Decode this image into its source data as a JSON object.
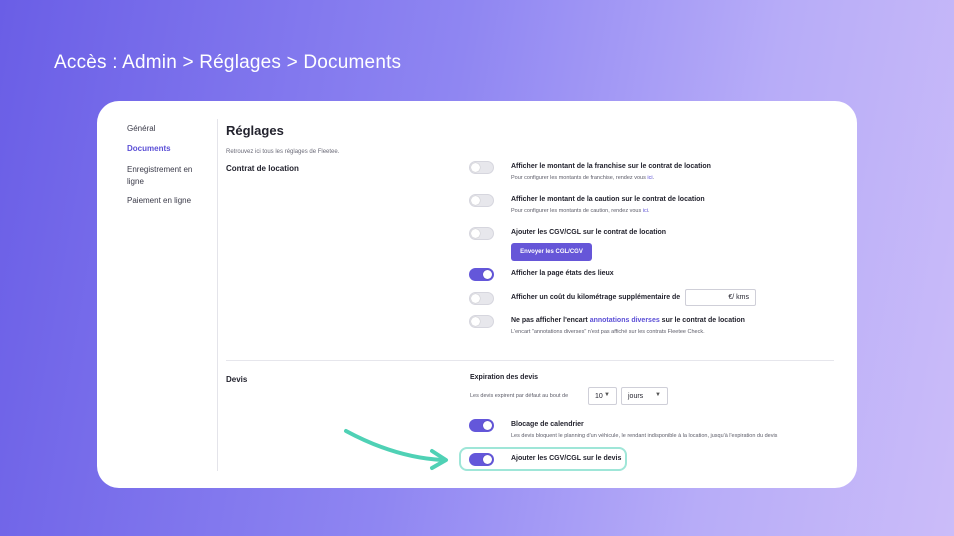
{
  "header": {
    "access_path": "Accès : Admin > Réglages > Documents"
  },
  "sidebar": {
    "items": [
      {
        "label": "Général"
      },
      {
        "label": "Documents"
      },
      {
        "label": "Enregistrement en ligne"
      },
      {
        "label": "Paiement en ligne"
      }
    ]
  },
  "page": {
    "title": "Réglages",
    "subtitle": "Retrouvez ici tous les réglages de Fleetee."
  },
  "contrat": {
    "section_label": "Contrat de location",
    "franchise": {
      "label": "Afficher le montant de la franchise sur le contrat de location",
      "sub_text": "Pour configurer les montants de franchise, rendez vous ",
      "sub_link": "ici",
      "sub_end": ".",
      "enabled": false
    },
    "caution": {
      "label": "Afficher le montant de la caution sur le contrat de location",
      "sub_text": "Pour configurer les montants de caution, rendez vous ",
      "sub_link": "ici",
      "sub_end": ".",
      "enabled": false
    },
    "cgv": {
      "label": "Ajouter les CGV/CGL sur le contrat de location",
      "button": "Envoyer les CGL/CGV",
      "enabled": false
    },
    "etats_lieux": {
      "label": "Afficher la page états des lieux",
      "enabled": true
    },
    "kilometrage": {
      "label": "Afficher un coût du kilométrage supplémentaire de",
      "unit": "€/ kms",
      "enabled": false
    },
    "annotations": {
      "label_pre": "Ne pas afficher l'encart ",
      "label_link": "annotations diverses",
      "label_post": " sur le contrat de location",
      "sub": "L'encart \"annotations diverses\" n'est pas affiché sur les contrats Fleetee Check.",
      "enabled": false
    }
  },
  "devis": {
    "section_label": "Devis",
    "expiration": {
      "title": "Expiration des devis",
      "text": "Les devis expirent par défaut au bout de",
      "value": "10",
      "unit": "jours"
    },
    "blocage": {
      "label": "Blocage de calendrier",
      "sub": "Les devis bloquent le planning d'un véhicule, le rendant indisponible à la location, jusqu'à l'expiration du devis",
      "enabled": true
    },
    "cgv_devis": {
      "label": "Ajouter les CGV/CGL sur le devis",
      "enabled": true
    }
  },
  "colors": {
    "accent": "#6457da",
    "highlight": "#9fe6d8",
    "arrow": "#4fd1b5"
  },
  "icons": {
    "dropdown": "chevron-down-icon",
    "pointer": "curved-arrow-icon"
  }
}
